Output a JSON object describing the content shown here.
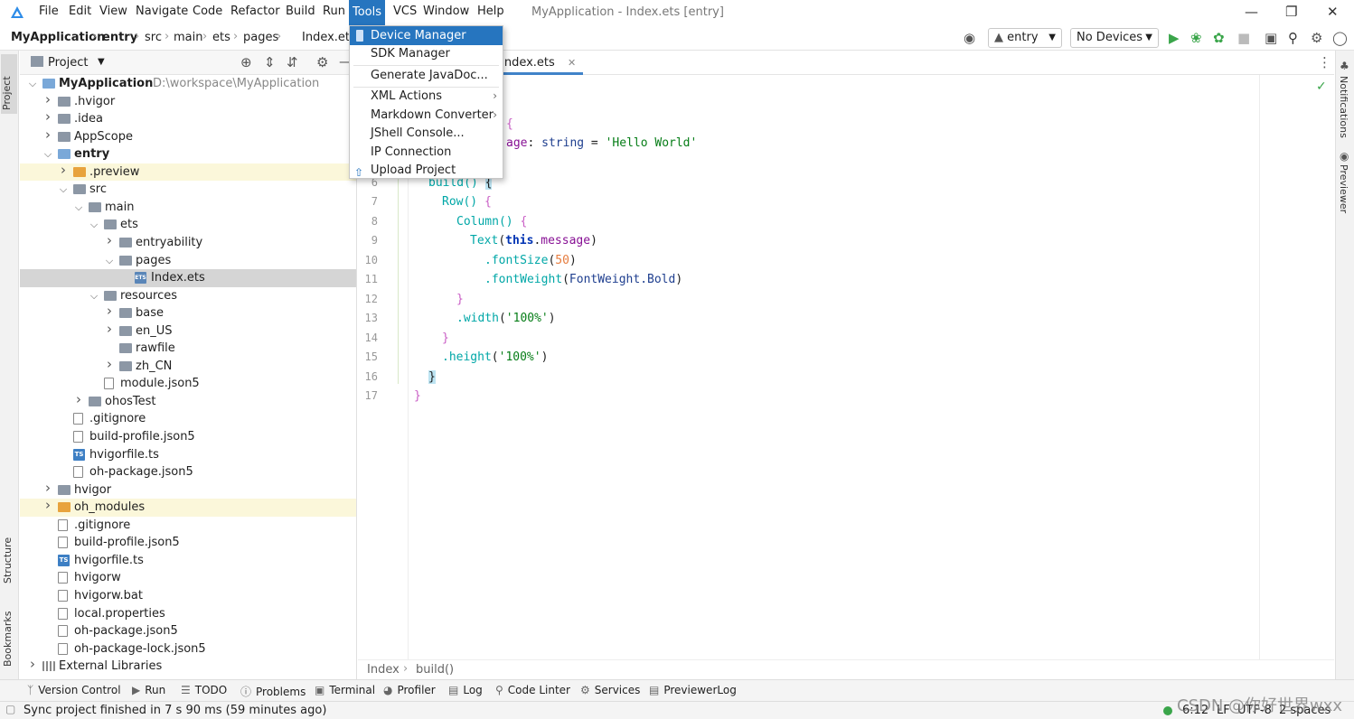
{
  "menubar": {
    "items": [
      "File",
      "Edit",
      "View",
      "Navigate",
      "Code",
      "Refactor",
      "Build",
      "Run",
      "Tools",
      "VCS",
      "Window",
      "Help"
    ],
    "window_title": "MyApplication - Index.ets [entry]"
  },
  "navbar": {
    "breadcrumbs": [
      "MyApplication",
      "entry",
      "src",
      "main",
      "ets",
      "pages",
      "Index.ets"
    ],
    "run_config": "entry",
    "device": "No Devices"
  },
  "tools_menu": {
    "items": [
      {
        "label": "Device Manager",
        "submenu": false
      },
      {
        "label": "SDK Manager",
        "submenu": false
      },
      {
        "label": "Generate JavaDoc...",
        "submenu": false
      },
      {
        "label": "XML Actions",
        "submenu": true
      },
      {
        "label": "Markdown Converter",
        "submenu": true
      },
      {
        "label": "JShell Console...",
        "submenu": false
      },
      {
        "label": "IP Connection",
        "submenu": false
      },
      {
        "label": "Upload Project",
        "submenu": false
      }
    ]
  },
  "project_panel": {
    "title": "Project",
    "tree": [
      {
        "name": "MyApplication",
        "path": "D:\\workspace\\MyApplication"
      },
      {
        "name": ".hvigor"
      },
      {
        "name": ".idea"
      },
      {
        "name": "AppScope"
      },
      {
        "name": "entry"
      },
      {
        "name": ".preview"
      },
      {
        "name": "src"
      },
      {
        "name": "main"
      },
      {
        "name": "ets"
      },
      {
        "name": "entryability"
      },
      {
        "name": "pages"
      },
      {
        "name": "Index.ets"
      },
      {
        "name": "resources"
      },
      {
        "name": "base"
      },
      {
        "name": "en_US"
      },
      {
        "name": "rawfile"
      },
      {
        "name": "zh_CN"
      },
      {
        "name": "module.json5"
      },
      {
        "name": "ohosTest"
      },
      {
        "name": ".gitignore"
      },
      {
        "name": "build-profile.json5"
      },
      {
        "name": "hvigorfile.ts"
      },
      {
        "name": "oh-package.json5"
      },
      {
        "name": "hvigor"
      },
      {
        "name": "oh_modules"
      },
      {
        "name": ".gitignore"
      },
      {
        "name": "build-profile.json5"
      },
      {
        "name": "hvigorfile.ts"
      },
      {
        "name": "hvigorw"
      },
      {
        "name": "hvigorw.bat"
      },
      {
        "name": "local.properties"
      },
      {
        "name": "oh-package.json5"
      },
      {
        "name": "oh-package-lock.json5"
      },
      {
        "name": "External Libraries"
      }
    ]
  },
  "editor": {
    "tab": "Index.ets",
    "line_numbers": [
      "6",
      "7",
      "8",
      "9",
      "10",
      "11",
      "12",
      "13",
      "14",
      "15",
      "16",
      "17"
    ],
    "code": {
      "l2_brace": "{",
      "l3_message": "age",
      "l3_type": "string",
      "l3_value": "'Hello World'",
      "build": "build()",
      "row": "Row()",
      "column": "Column()",
      "text_call": "Text",
      "this_kw": "this",
      "message": "message",
      "fontsize": ".fontSize",
      "fontsize_val": "50",
      "fontweight": ".fontWeight",
      "fontweight_val": "FontWeight.Bold",
      "width": ".width",
      "width_val": "'100%'",
      "height": ".height",
      "height_val": "'100%'"
    },
    "crumbs": [
      "Index",
      "build()"
    ]
  },
  "left_stripe": {
    "project": "Project",
    "structure": "Structure",
    "bookmarks": "Bookmarks"
  },
  "right_stripe": {
    "notifications": "Notifications",
    "previewer": "Previewer"
  },
  "tool_windows": [
    "Version Control",
    "Run",
    "TODO",
    "Problems",
    "Terminal",
    "Profiler",
    "Log",
    "Code Linter",
    "Services",
    "PreviewerLog"
  ],
  "status": {
    "message": "Sync project finished in 7 s 90 ms (59 minutes ago)",
    "position": "6:12",
    "line_sep": "LF",
    "encoding": "UTF-8",
    "indent": "2 spaces",
    "watermark": "CSDN @你好世界wxx"
  },
  "colors": {
    "accent": "#2675bf",
    "tab_underline": "#4083c9"
  }
}
